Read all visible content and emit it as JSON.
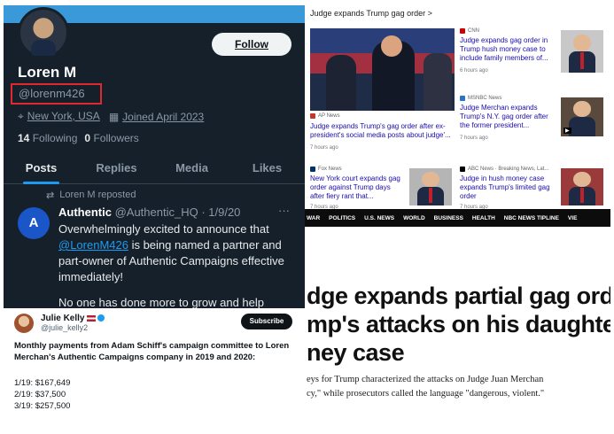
{
  "profile": {
    "follow_label": "Follow",
    "name": "Loren M",
    "handle": "@lorenm426",
    "location": "New York, USA",
    "joined": "Joined April 2023",
    "following_count": "14",
    "following_label": "Following",
    "followers_count": "0",
    "followers_label": "Followers",
    "tabs": [
      {
        "label": "Posts"
      },
      {
        "label": "Replies"
      },
      {
        "label": "Media"
      },
      {
        "label": "Likes"
      }
    ]
  },
  "tweet": {
    "repost_label": "Loren M reposted",
    "author_name": "Authentic",
    "author_handle_date": "@Authentic_HQ · 1/9/20",
    "avatar_letter": "A",
    "text_1": "Overwhelmingly excited to announce that ",
    "mention": "@LorenM426",
    "text_2": " is being named a partner and part-owner of Authentic Campaigns effective immediately!",
    "text_3": "No one has done more to grow and help"
  },
  "julie": {
    "name": "Julie Kelly",
    "handle": "@julie_kelly2",
    "subscribe_label": "Subscribe",
    "text": "Monthly payments from Adam Schiff's campaign committee to Loren Merchan's Authentic Campaigns company in 2019 and 2020:",
    "payments": [
      "1/19: $167,649",
      "2/19: $37,500",
      "3/19: $257,500"
    ]
  },
  "news": {
    "header": "Judge expands Trump gag order  >",
    "main": {
      "source": "AP News",
      "title": "Judge expands Trump's gag order after ex-president's social media posts about judge'...",
      "time": "7 hours ago"
    },
    "items": [
      {
        "source": "CNN",
        "title": "Judge expands gag order in Trump hush money case to include family members of...",
        "time": "6 hours ago"
      },
      {
        "source": "MSNBC News",
        "title": "Judge Merchan expands Trump's N.Y. gag order after the former president...",
        "time": "7 hours ago",
        "badge": "Video"
      },
      {
        "source": "Fox News",
        "title": "New York court expands gag order against Trump days after fiery rant that...",
        "time": "7 hours ago"
      },
      {
        "source": "ABC News · Breaking News, Lat...",
        "title": "Judge in hush money case expands Trump's limited gag order",
        "time": "7 hours ago"
      }
    ],
    "colors": {
      "cnn": "#cc0000",
      "msnbc": "#2d73c5",
      "fox": "#003366",
      "abc": "#000000",
      "ap": "#c0392b"
    }
  },
  "article": {
    "nav": [
      "WAR",
      "POLITICS",
      "U.S. NEWS",
      "WORLD",
      "BUSINESS",
      "HEALTH",
      "NBC NEWS TIPLINE",
      "VIE"
    ],
    "headline_1": "dge expands partial gag order",
    "headline_2": "mp's attacks on his daughter",
    "headline_3": "ney case",
    "body_1": "eys for Trump characterized the attacks on Judge Juan Merchan",
    "body_2": "cy,\" while prosecutors called the language \"dangerous, violent.\""
  }
}
